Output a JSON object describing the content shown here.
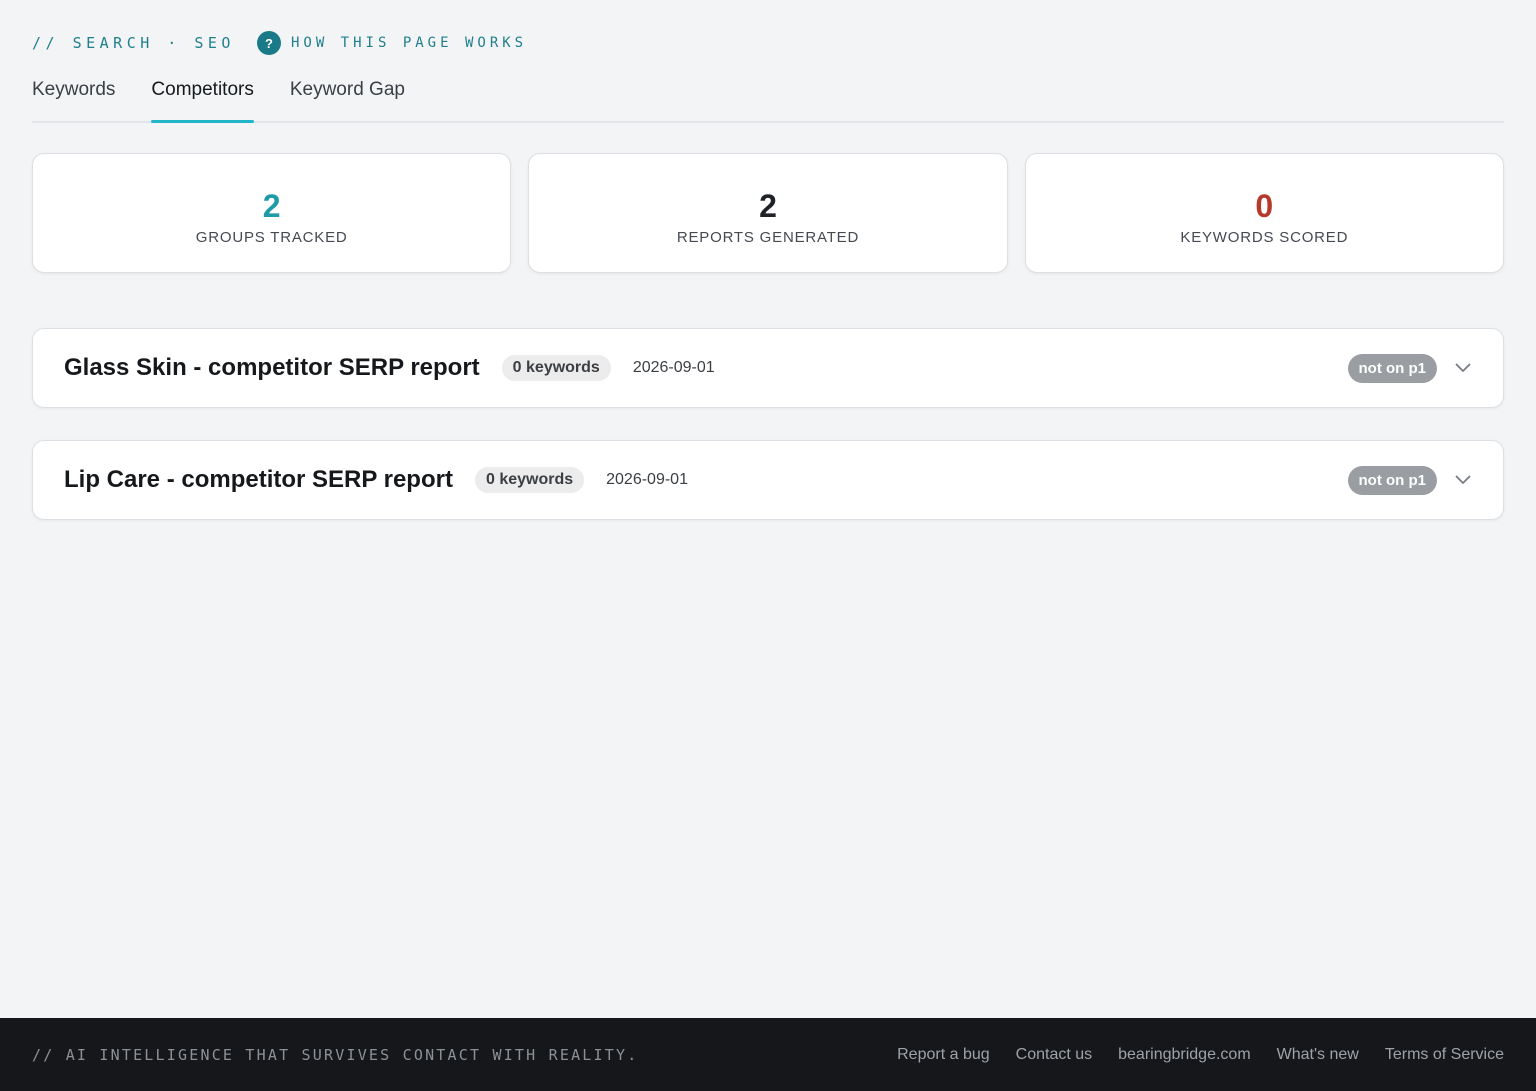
{
  "header": {
    "eyebrow": "// SEARCH · SEO",
    "help_icon_glyph": "?",
    "help_link": "HOW THIS PAGE WORKS"
  },
  "tabs": [
    {
      "label": "Keywords",
      "active": false
    },
    {
      "label": "Competitors",
      "active": true
    },
    {
      "label": "Keyword Gap",
      "active": false
    }
  ],
  "stats": [
    {
      "value": "2",
      "label": "GROUPS TRACKED",
      "color": "#1e9aa8"
    },
    {
      "value": "2",
      "label": "REPORTS GENERATED",
      "color": "#1f2327"
    },
    {
      "value": "0",
      "label": "KEYWORDS SCORED",
      "color": "#b53a2c"
    }
  ],
  "reports": [
    {
      "title": "Glass Skin - competitor SERP report",
      "keywords": "0 keywords",
      "date": "2026-09-01",
      "status": "not on p1",
      "icon": "chevron-down-icon"
    },
    {
      "title": "Lip Care - competitor SERP report",
      "keywords": "0 keywords",
      "date": "2026-09-01",
      "status": "not on p1",
      "icon": "chevron-down-icon"
    }
  ],
  "footer": {
    "tagline": "// AI INTELLIGENCE THAT SURVIVES CONTACT WITH REALITY.",
    "links": [
      "Report a bug",
      "Contact us",
      "bearingbridge.com",
      "What's new",
      "Terms of Service"
    ]
  }
}
